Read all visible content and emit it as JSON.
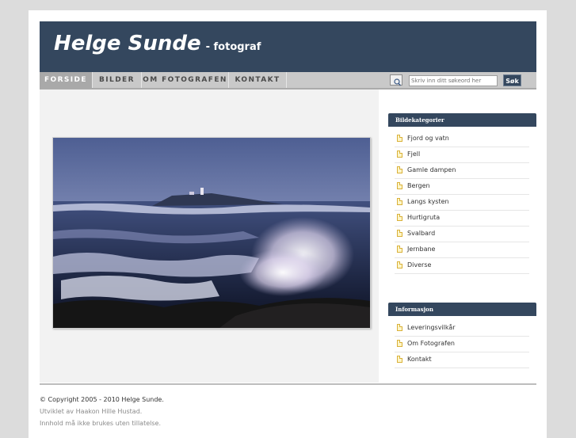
{
  "header": {
    "title": "Helge Sunde",
    "subtitle": "- fotograf"
  },
  "nav": {
    "items": [
      {
        "label": "FORSIDE",
        "active": true
      },
      {
        "label": "BILDER",
        "active": false
      },
      {
        "label": "OM FOTOGRAFEN",
        "active": false
      },
      {
        "label": "KONTAKT",
        "active": false
      }
    ]
  },
  "search": {
    "placeholder": "Skriv inn ditt søkeord her",
    "button_label": "Søk",
    "icon": "search-icon"
  },
  "main": {
    "photo_subject": "stormy sea with waves breaking on rocks and a lighthouse island"
  },
  "sidebar": {
    "categories": {
      "heading": "Bildekategorier",
      "items": [
        "Fjord og vatn",
        "Fjell",
        "Gamle dampen",
        "Bergen",
        "Langs kysten",
        "Hurtigruta",
        "Svalbard",
        "Jernbane",
        "Diverse"
      ]
    },
    "info": {
      "heading": "Informasjon",
      "items": [
        "Leveringsvilkår",
        "Om Fotografen",
        "Kontakt"
      ]
    },
    "item_icon": "document-icon"
  },
  "footer": {
    "copyright": "© Copyright 2005 - 2010 Helge Sunde.",
    "developer": "Utviklet av Haakon Hille Hustad.",
    "notice": "Innhold må ikke brukes uten tillatelse."
  },
  "colors": {
    "header_bg": "#34475e",
    "page_bg": "#dcdcdc",
    "nav_bg": "#c9c9c9",
    "main_bg": "#f2f2f2"
  }
}
